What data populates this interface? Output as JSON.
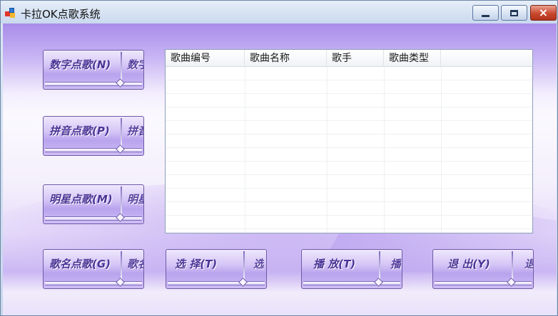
{
  "window": {
    "title": "卡拉OK点歌系统",
    "controls": {
      "close": "×"
    }
  },
  "side_buttons": [
    {
      "label": "数字点歌(N)",
      "ghost": "数字"
    },
    {
      "label": "拼音点歌(P)",
      "ghost": "拼音"
    },
    {
      "label": "明星点歌(M)",
      "ghost": "明星"
    },
    {
      "label": "歌名点歌(G)",
      "ghost": "歌名"
    }
  ],
  "bottom_buttons": [
    {
      "label": "选 择(T)",
      "ghost": "选"
    },
    {
      "label": "播 放(T)",
      "ghost": "播"
    },
    {
      "label": "退 出(Y)",
      "ghost": "退"
    }
  ],
  "song_table": {
    "columns": [
      "歌曲编号",
      "歌曲名称",
      "歌手",
      "歌曲类型"
    ],
    "rows": []
  },
  "colors": {
    "accent": "#4b3596",
    "button_top": "#efe8fd",
    "button_mid": "#b9a3ee",
    "close_red": "#c8492e"
  }
}
